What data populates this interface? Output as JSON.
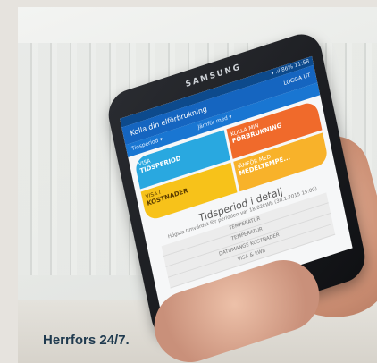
{
  "phone": {
    "brand": "SAMSUNG",
    "status": "▾ .ıl 86% 11:58",
    "app_title": "Kolla din elförbrukning",
    "logout": "LOGGA UT",
    "filters": [
      "Tidsperiod ▾",
      "Jämför med ▾"
    ],
    "tiles": [
      {
        "small": "VISA",
        "big": "TIDSPERIOD"
      },
      {
        "small": "KOLLA MIN",
        "big": "FÖRBRUKNING"
      },
      {
        "small": "VISA I",
        "big": "KOSTNADER"
      },
      {
        "small": "JÄMFÖR MED",
        "big": "MEDELTEMPE..."
      }
    ],
    "detail_title": "Tidsperiod i detalj",
    "detail_sub": "Högsta timvärdet för perioden var 18.02kWh (30.1.2015 15:00)",
    "rows": [
      "TEMPERATUR",
      "TEMPERATUR",
      "DATUMANGE KOSTNADER",
      "VISA & kWh"
    ]
  },
  "caption": "Herrfors 24/7."
}
